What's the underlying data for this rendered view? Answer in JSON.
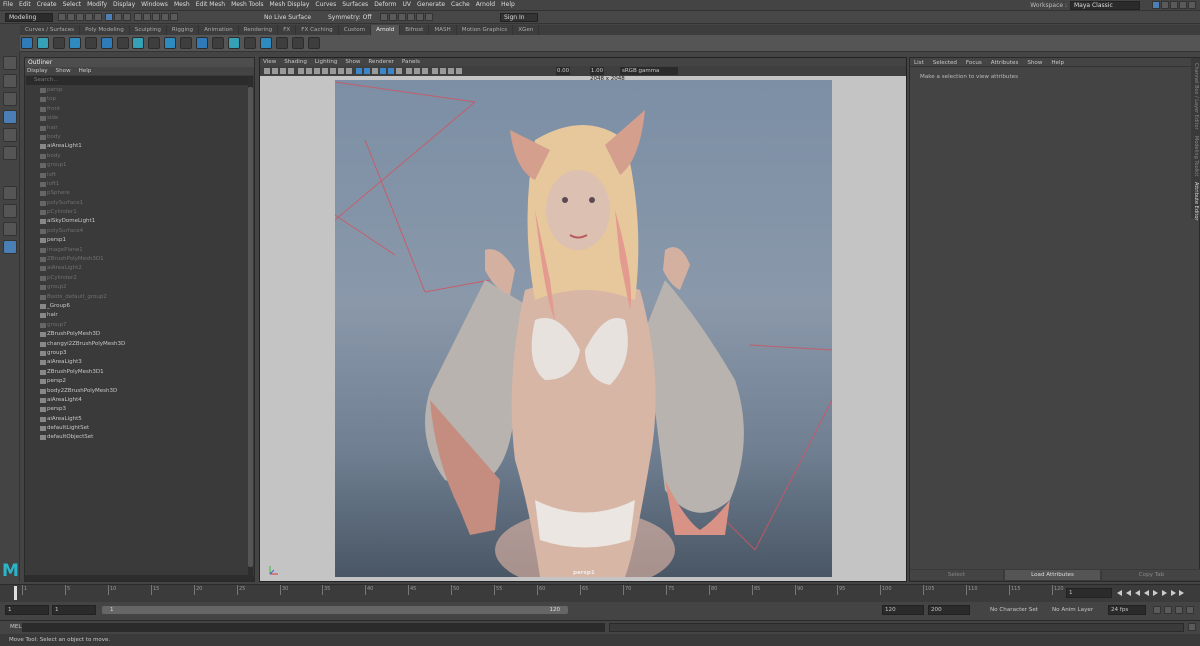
{
  "menubar": [
    "File",
    "Edit",
    "Create",
    "Select",
    "Modify",
    "Display",
    "Windows",
    "Mesh",
    "Edit Mesh",
    "Mesh Tools",
    "Mesh Display",
    "Curves",
    "Surfaces",
    "Deform",
    "UV",
    "Generate",
    "Cache",
    "Arnold",
    "Help"
  ],
  "workspace": {
    "label": "Workspace :",
    "value": "Maya Classic"
  },
  "statusline": {
    "mode": "Modeling",
    "live_surface": "No Live Surface",
    "symmetry": "Symmetry: Off",
    "sign_in": "Sign In"
  },
  "shelf_tabs": [
    "Curves / Surfaces",
    "Poly Modeling",
    "Sculpting",
    "Rigging",
    "Animation",
    "Rendering",
    "FX",
    "FX Caching",
    "Custom",
    "Arnold",
    "Bifrost",
    "MASH",
    "Motion Graphics",
    "XGen"
  ],
  "shelf_active": "Arnold",
  "outliner": {
    "title": "Outliner",
    "menu": [
      "Display",
      "Show",
      "Help"
    ],
    "search_placeholder": "Search...",
    "items": [
      {
        "label": "persp",
        "dim": true
      },
      {
        "label": "top",
        "dim": true
      },
      {
        "label": "front",
        "dim": true
      },
      {
        "label": "side",
        "dim": true
      },
      {
        "label": "hair",
        "dim": true
      },
      {
        "label": "body",
        "dim": true
      },
      {
        "label": "aiAreaLight1",
        "dim": false
      },
      {
        "label": "body",
        "dim": true
      },
      {
        "label": "group1",
        "dim": true
      },
      {
        "label": "loft",
        "dim": true
      },
      {
        "label": "loft1",
        "dim": true
      },
      {
        "label": "pSphere",
        "dim": true
      },
      {
        "label": "polySurface1",
        "dim": true
      },
      {
        "label": "pCylinder1",
        "dim": true
      },
      {
        "label": "aiSkyDomeLight1",
        "dim": false
      },
      {
        "label": "polySurface4",
        "dim": true
      },
      {
        "label": "persp1",
        "dim": false
      },
      {
        "label": "imagePlane1",
        "dim": true
      },
      {
        "label": "ZBrushPolyMesh3D1",
        "dim": true
      },
      {
        "label": "aiAreaLight2",
        "dim": true
      },
      {
        "label": "pCylinder2",
        "dim": true
      },
      {
        "label": "group2",
        "dim": true
      },
      {
        "label": "Boots_default_group2",
        "dim": true
      },
      {
        "label": "_Group6",
        "dim": false
      },
      {
        "label": "hair",
        "dim": false
      },
      {
        "label": "group7",
        "dim": true
      },
      {
        "label": "ZBrushPolyMesh3D",
        "dim": false
      },
      {
        "label": "changyi2ZBrushPolyMesh3D",
        "dim": false
      },
      {
        "label": "group3",
        "dim": false
      },
      {
        "label": "aiAreaLight3",
        "dim": false
      },
      {
        "label": "ZBrushPolyMesh3D1",
        "dim": false
      },
      {
        "label": "persp2",
        "dim": false
      },
      {
        "label": "body2ZBrushPolyMesh3D",
        "dim": false
      },
      {
        "label": "aiAreaLight4",
        "dim": false
      },
      {
        "label": "persp3",
        "dim": false
      },
      {
        "label": "aiAreaLight5",
        "dim": false
      },
      {
        "label": "defaultLightSet",
        "dim": false
      },
      {
        "label": "defaultObjectSet",
        "dim": false
      }
    ]
  },
  "viewport": {
    "menu": [
      "View",
      "Shading",
      "Lighting",
      "Show",
      "Renderer",
      "Panels"
    ],
    "exposure": "0.00",
    "gamma": "1.00",
    "color_space": "sRGB gamma",
    "resolution": "2048 x 2048",
    "camera": "persp1"
  },
  "attribute_editor": {
    "menu": [
      "List",
      "Selected",
      "Focus",
      "Attributes",
      "Show",
      "Help"
    ],
    "hint": "Make a selection to view attributes",
    "buttons": [
      "Select",
      "Load Attributes",
      "Copy Tab"
    ]
  },
  "side_tabs": [
    "Channel Box / Layer Editor",
    "Modeling Toolkit",
    "Attribute Editor"
  ],
  "timeline": {
    "ticks": [
      "1",
      "5",
      "10",
      "15",
      "20",
      "25",
      "30",
      "35",
      "40",
      "45",
      "50",
      "55",
      "60",
      "65",
      "70",
      "75",
      "80",
      "85",
      "90",
      "95",
      "100",
      "105",
      "110",
      "115",
      "120"
    ],
    "current_frame": "1"
  },
  "range": {
    "start": "1",
    "anim_start": "1",
    "slider_start": "1",
    "slider_end": "120",
    "anim_end": "120",
    "end": "200",
    "character_set": "No Character Set",
    "anim_layer": "No Anim Layer",
    "fps": "24 fps"
  },
  "command": {
    "lang": "MEL"
  },
  "help_line": "Move Tool: Select an object to move."
}
